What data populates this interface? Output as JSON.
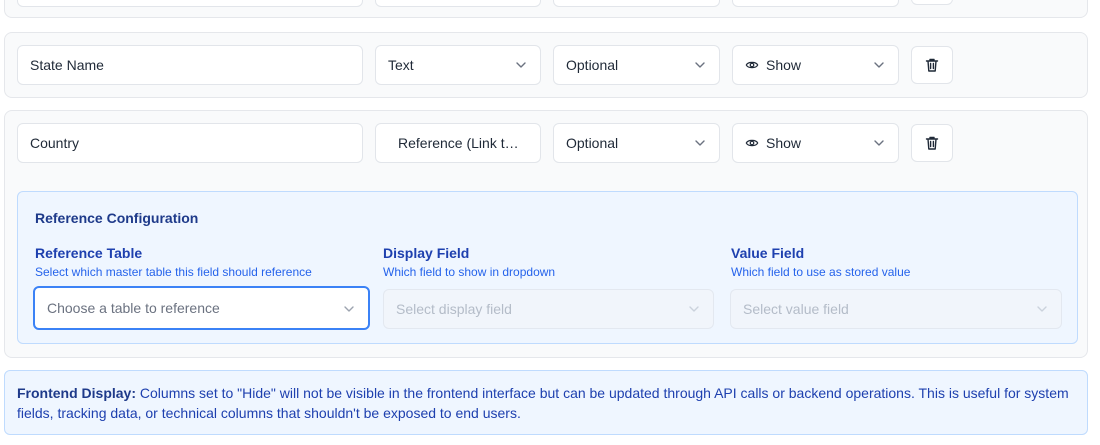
{
  "fields": [
    {
      "name_value": "State Name",
      "type_value": "Text",
      "required_value": "Optional",
      "visibility_value": "Show"
    },
    {
      "name_value": "Country",
      "type_value": "Reference (Link to...",
      "required_value": "Optional",
      "visibility_value": "Show"
    }
  ],
  "reference_config": {
    "title": "Reference Configuration",
    "reference_table": {
      "label": "Reference Table",
      "help": "Select which master table this field should reference",
      "placeholder": "Choose a table to reference"
    },
    "display_field": {
      "label": "Display Field",
      "help": "Which field to show in dropdown",
      "placeholder": "Select display field"
    },
    "value_field": {
      "label": "Value Field",
      "help": "Which field to use as stored value",
      "placeholder": "Select value field"
    }
  },
  "info": {
    "heading": "Frontend Display:",
    "text": " Columns set to \"Hide\" will not be visible in the frontend interface but can be updated through API calls or backend operations. This is useful for system fields, tracking data, or technical columns that shouldn't be exposed to end users."
  },
  "colors": {
    "accent": "#3b82f6",
    "panel_bg": "#eff6ff",
    "panel_border": "#bfdbfe",
    "label_blue": "#1e40af"
  },
  "icons": {
    "chevron": "chevron-down-icon",
    "eye": "eye-icon",
    "delete": "trash-icon"
  }
}
